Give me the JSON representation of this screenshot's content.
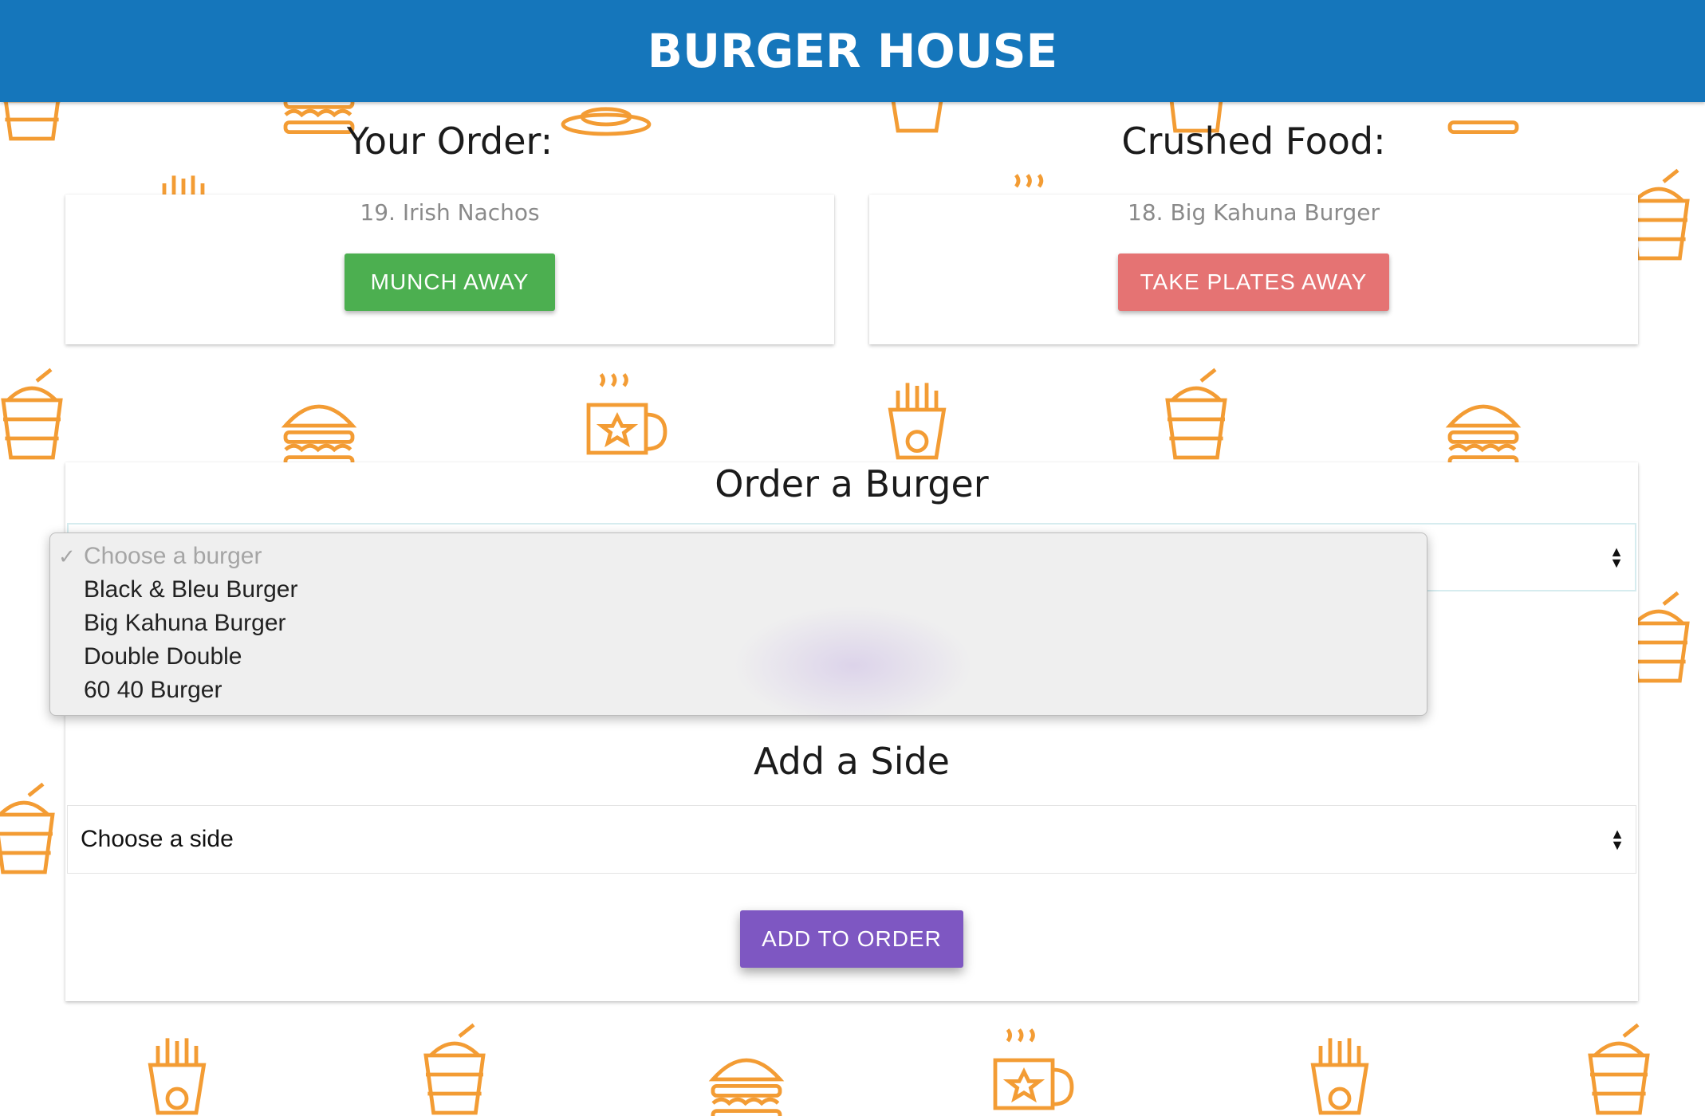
{
  "header": {
    "title": "BURGER HOUSE"
  },
  "your_order": {
    "heading": "Your Order:",
    "item": "19. Irish Nachos",
    "button_label": "MUNCH AWAY"
  },
  "crushed_food": {
    "heading": "Crushed Food:",
    "item": "18. Big Kahuna Burger",
    "button_label": "TAKE PLATES AWAY"
  },
  "order_form": {
    "burger_heading": "Order a Burger",
    "burger_select": {
      "options": [
        {
          "label": "Choose a burger",
          "placeholder": true,
          "checked": true
        },
        {
          "label": "Black & Bleu Burger"
        },
        {
          "label": "Big Kahuna Burger"
        },
        {
          "label": "Double Double"
        },
        {
          "label": "60 40 Burger"
        }
      ]
    },
    "side_heading": "Add a Side",
    "side_select": {
      "value": "Choose a side"
    },
    "add_button_label": "ADD TO ORDER"
  },
  "colors": {
    "header": "#1576bb",
    "munch": "#4caf50",
    "take_plates": "#e57373",
    "add_to_order": "#7e57c2",
    "icon_stroke": "#f39c34"
  },
  "background_icons": [
    "drink-icon",
    "burger-icon",
    "coffee-mug-icon",
    "fries-icon"
  ]
}
